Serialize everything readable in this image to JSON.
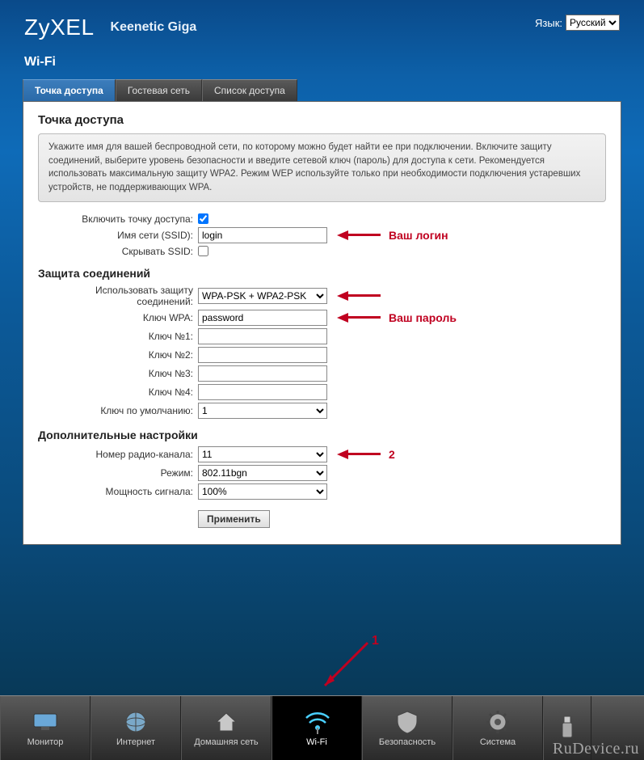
{
  "brand": "ZyXEL",
  "model": "Keenetic Giga",
  "lang_label": "Язык:",
  "lang_value": "Русский",
  "page_title": "Wi-Fi",
  "tabs": [
    {
      "label": "Точка доступа",
      "active": true
    },
    {
      "label": "Гостевая сеть",
      "active": false
    },
    {
      "label": "Список доступа",
      "active": false
    }
  ],
  "panel": {
    "title": "Точка доступа",
    "hint": "Укажите имя для вашей беспроводной сети, по которому можно будет найти ее при подключении. Включите защиту соединений, выберите уровень безопасности и введите сетевой ключ (пароль) для доступа к сети. Рекомендуется использовать максимальную защиту WPA2. Режим WEP используйте только при необходимости подключения устаревших устройств, не поддерживающих WPA.",
    "fields": {
      "enable_ap_label": "Включить точку доступа:",
      "enable_ap_checked": true,
      "ssid_label": "Имя сети (SSID):",
      "ssid_value": "login",
      "hide_ssid_label": "Скрывать SSID:",
      "hide_ssid_checked": false
    },
    "security": {
      "section_title": "Защита соединений",
      "mode_label": "Использовать защиту соединений:",
      "mode_value": "WPA-PSK + WPA2-PSK",
      "wpa_key_label": "Ключ WPA:",
      "wpa_key_value": "password",
      "key1_label": "Ключ №1:",
      "key1_value": "",
      "key2_label": "Ключ №2:",
      "key2_value": "",
      "key3_label": "Ключ №3:",
      "key3_value": "",
      "key4_label": "Ключ №4:",
      "key4_value": "",
      "key_default_label": "Ключ по умолчанию:",
      "key_default_value": "1"
    },
    "extra": {
      "section_title": "Дополнительные настройки",
      "channel_label": "Номер радио-канала:",
      "channel_value": "11",
      "mode_label": "Режим:",
      "mode_value": "802.11bgn",
      "power_label": "Мощность сигнала:",
      "power_value": "100%"
    },
    "apply_label": "Применить"
  },
  "callouts": {
    "login": "Ваш логин",
    "password": "Ваш пароль",
    "one": "1",
    "two": "2"
  },
  "nav": [
    {
      "label": "Монитор",
      "icon": "monitor-icon"
    },
    {
      "label": "Интернет",
      "icon": "internet-icon"
    },
    {
      "label": "Домашняя сеть",
      "icon": "home-icon"
    },
    {
      "label": "Wi-Fi",
      "icon": "wifi-icon",
      "active": true
    },
    {
      "label": "Безопасность",
      "icon": "security-icon"
    },
    {
      "label": "Система",
      "icon": "system-icon"
    },
    {
      "label": "",
      "icon": "usb-icon"
    }
  ],
  "watermark": "RuDevice.ru"
}
